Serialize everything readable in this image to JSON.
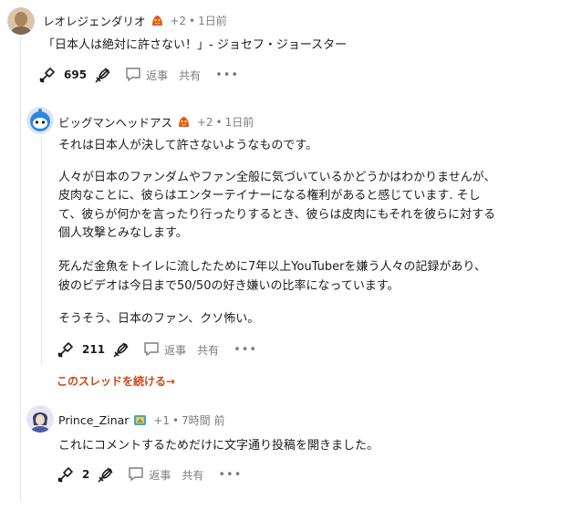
{
  "colors": {
    "link": "#c9471b",
    "muted": "#7c7c7c",
    "thread_line": "#e2e4e6"
  },
  "comments": [
    {
      "username": "レオレジェンダリオ",
      "points": "+2",
      "time": "1日前",
      "body": [
        "「日本人は絶対に許さない！」- ジョセフ・ジョースター"
      ],
      "score": "695",
      "reply_label": "返事",
      "share_label": "共有",
      "more_label": "•••"
    },
    {
      "username": "ビッグマンヘッドアス",
      "points": "+2",
      "time": "1日前",
      "body": [
        "それは日本人が決して許さないようなものです。",
        "人々が日本のファンダムやファン全般に気づいているかどうかはわかりませんが、",
        "皮肉なことに、彼らはエンターテイナーになる権利があると感じています. そし",
        "て、彼らが何かを言ったり行ったりするとき、彼らは皮肉にもそれを彼らに対する",
        "個人攻撃とみなします。",
        "死んだ金魚をトイレに流したために7年以上YouTuberを嫌う人々の記録があり、",
        "彼のビデオは今日まで50/50の好き嫌いの比率になっています。",
        "そうそう、日本のファン、クソ怖い。"
      ],
      "score": "211",
      "reply_label": "返事",
      "share_label": "共有",
      "more_label": "•••",
      "continue_label": "このスレッドを続ける→"
    },
    {
      "username": "Prince_Zinar",
      "points": "+1",
      "time": "7時間 前",
      "body": [
        "これにコメントするためだけに文字通り投稿を開きました。"
      ],
      "score": "2",
      "reply_label": "返事",
      "share_label": "共有",
      "more_label": "•••"
    }
  ]
}
